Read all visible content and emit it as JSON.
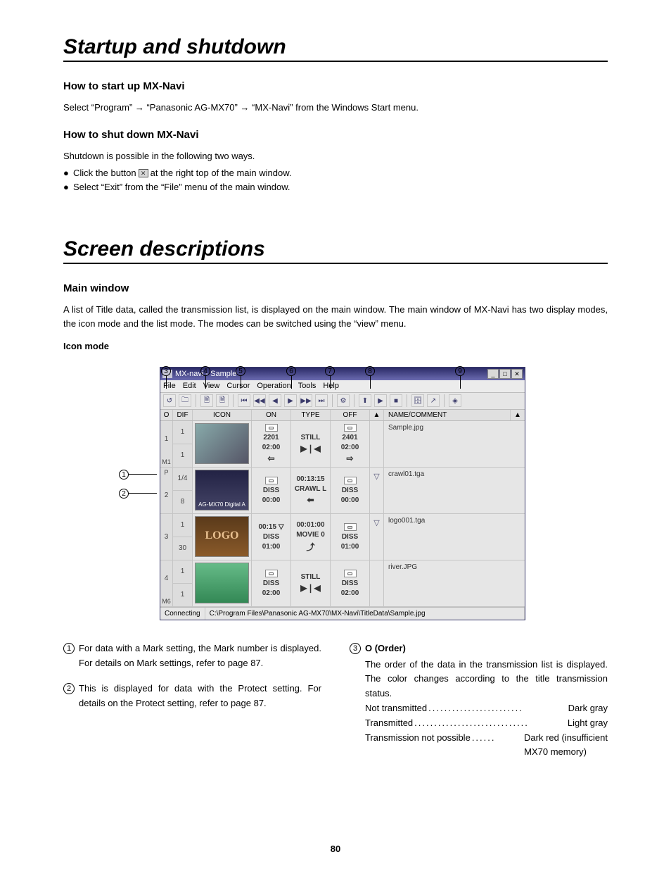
{
  "section1": {
    "title": "Startup and shutdown",
    "start_head": "How to start up MX-Navi",
    "start_text": "Select “Program” → “Panasonic AG-MX70” → “MX-Navi” from the Windows Start menu.",
    "shut_head": "How to shut down MX-Navi",
    "shut_intro": "Shutdown is possible in the following two ways.",
    "bullet1a": "Click the button",
    "bullet1b": "at the right top of the main window.",
    "bullet2": "Select “Exit” from the “File” menu of the main window."
  },
  "section2": {
    "title": "Screen descriptions",
    "main_head": "Main window",
    "main_text": "A list of Title data, called the transmission list, is displayed on the main window.  The main window of MX-Navi has two display modes, the icon mode and the list mode.  The modes can be switched using the “view” menu.",
    "icon_mode_label": "Icon mode"
  },
  "callouts": {
    "c1": "1",
    "c2": "2",
    "c3": "3",
    "c4": "4",
    "c5": "5",
    "c6": "6",
    "c7": "7",
    "c8": "8",
    "c9": "9"
  },
  "window": {
    "title": "MX-navi - Sample",
    "menus": [
      "File",
      "Edit",
      "View",
      "Cursor",
      "Operation",
      "Tools",
      "Help"
    ],
    "headers": {
      "o": "O",
      "dif": "DIF",
      "icon": "ICON",
      "on": "ON",
      "type": "TYPE",
      "off": "OFF",
      "tri": "▲",
      "name": "NAME/COMMENT",
      "end": "▲"
    },
    "rows": [
      {
        "order": "1",
        "mark": "M1",
        "dif": [
          "1",
          "1"
        ],
        "thumb_text": "",
        "on": [
          "▭",
          "2201",
          "02:00",
          "⇦"
        ],
        "type": [
          "STILL",
          "▶❘◀"
        ],
        "off": [
          "▭",
          "2401",
          "02:00",
          "⇨"
        ],
        "tri": "",
        "name": "Sample.jpg"
      },
      {
        "order": "2",
        "mark": "",
        "protect": "P",
        "dif": [
          "1/4",
          "8"
        ],
        "thumb_text": "AG-MX70  Digital A",
        "on": [
          "▭",
          "DISS",
          "00:00"
        ],
        "type": [
          "00:13:15",
          "CRAWL L",
          "⬅"
        ],
        "off": [
          "▭",
          "DISS",
          "00:00"
        ],
        "tri": "▽",
        "name": "crawl01.tga"
      },
      {
        "order": "3",
        "mark": "",
        "dif": [
          "1",
          "30"
        ],
        "thumb_text": "LOGO",
        "logo": true,
        "on": [
          "00:15 ▽",
          "DISS",
          "01:00"
        ],
        "type": [
          "00:01:00",
          "MOVIE 0",
          "⤴"
        ],
        "off": [
          "▭",
          "DISS",
          "01:00"
        ],
        "tri": "▽",
        "name": "logo001.tga"
      },
      {
        "order": "4",
        "mark": "M6",
        "dif": [
          "1",
          "1"
        ],
        "thumb_text": "",
        "on": [
          "▭",
          "DISS",
          "02:00"
        ],
        "type": [
          "STILL",
          "▶❘◀"
        ],
        "off": [
          "▭",
          "DISS",
          "02:00"
        ],
        "tri": "",
        "name": "river.JPG"
      }
    ],
    "status_left": "Connecting",
    "status_path": "C:\\Program Files\\Panasonic AG-MX70\\MX-Navi\\TitleData\\Sample.jpg"
  },
  "desc": {
    "item1": "For data with a Mark setting, the Mark number is displayed.  For details on Mark settings, refer to page 87.",
    "item2": "This is displayed for data with the Protect setting.  For details on the Protect setting, refer to page 87.",
    "item3_head": "O (Order)",
    "item3_body": "The order of the data in the transmission list is displayed.  The color changes according to the title transmission status.",
    "kv": [
      {
        "k": "Not transmitted",
        "v": "Dark gray"
      },
      {
        "k": "Transmitted",
        "v": "Light gray"
      },
      {
        "k": "Transmission not possible",
        "v": "Dark red (insufficient"
      }
    ],
    "trailing": "MX70 memory)"
  },
  "page_number": "80"
}
